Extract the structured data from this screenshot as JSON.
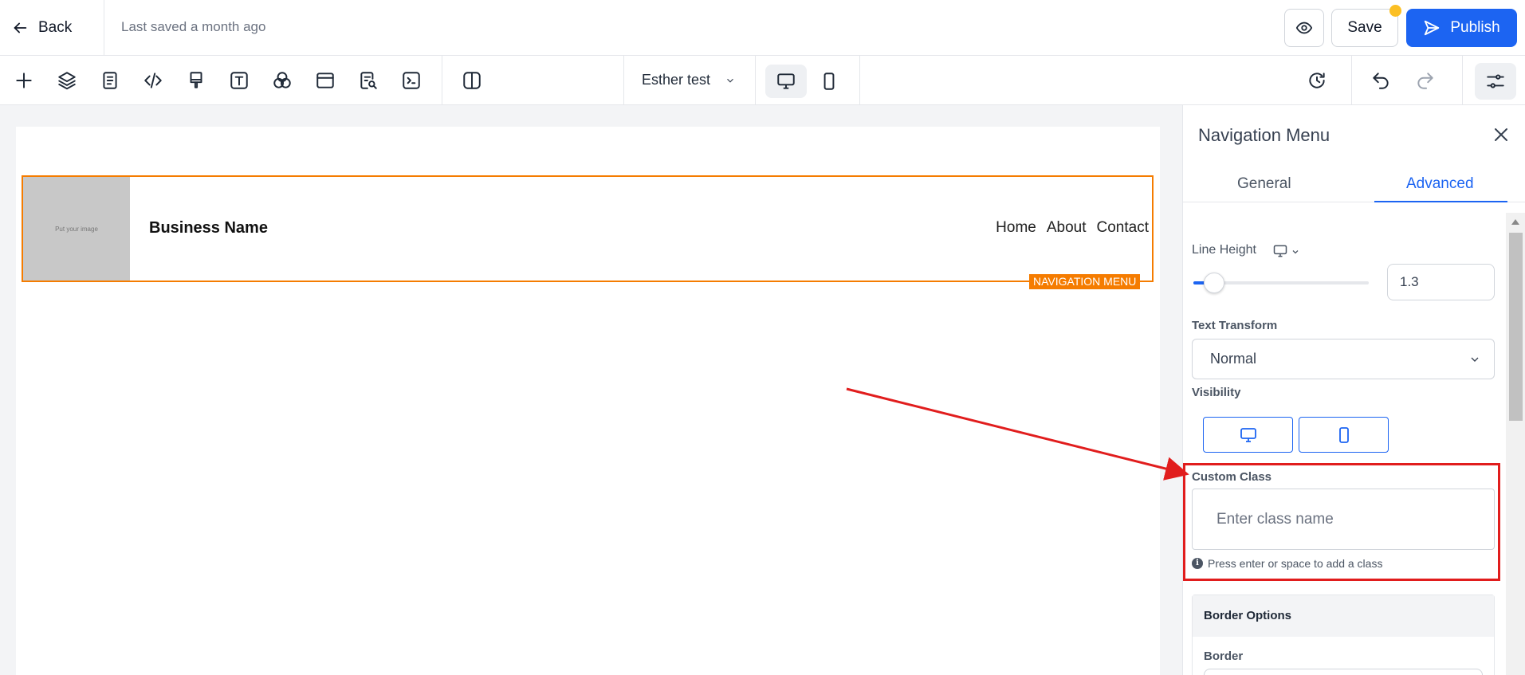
{
  "topbar": {
    "back_label": "Back",
    "saved_text": "Last saved a month ago",
    "save_label": "Save",
    "publish_label": "Publish"
  },
  "toolbar": {
    "tools": [
      "add-icon",
      "layers-icon",
      "page-icon",
      "code-icon",
      "paint-brush-icon",
      "text-icon",
      "color-circles-icon",
      "section-icon",
      "search-document-icon",
      "terminal-icon",
      "columns-icon"
    ],
    "page_select": "Esther test",
    "devices": [
      "desktop-icon",
      "mobile-icon"
    ],
    "right_tools": [
      "history-icon",
      "undo-icon",
      "redo-icon",
      "settings-sliders-icon"
    ]
  },
  "canvas": {
    "image_placeholder": "Put your image",
    "business_name": "Business Name",
    "nav_links": [
      "Home",
      "About",
      "Contact"
    ],
    "element_tag": "NAVIGATION MENU"
  },
  "panel": {
    "title": "Navigation Menu",
    "tabs": [
      "General",
      "Advanced"
    ],
    "active_tab": "Advanced",
    "line_height_label": "Line Height",
    "line_height_value": "1.3",
    "line_height_slider_fraction": 0.07,
    "text_transform_label": "Text Transform",
    "text_transform_value": "Normal",
    "visibility_label": "Visibility",
    "custom_class_label": "Custom Class",
    "custom_class_placeholder": "Enter class name",
    "custom_class_hint": "Press enter or space to add a class",
    "border_options_label": "Border Options",
    "border_label": "Border"
  },
  "colors": {
    "accent": "#1c64f2",
    "selection_orange": "#f57c00",
    "annotation_red": "#e11d1d",
    "unsaved_dot": "#fbbf24"
  }
}
